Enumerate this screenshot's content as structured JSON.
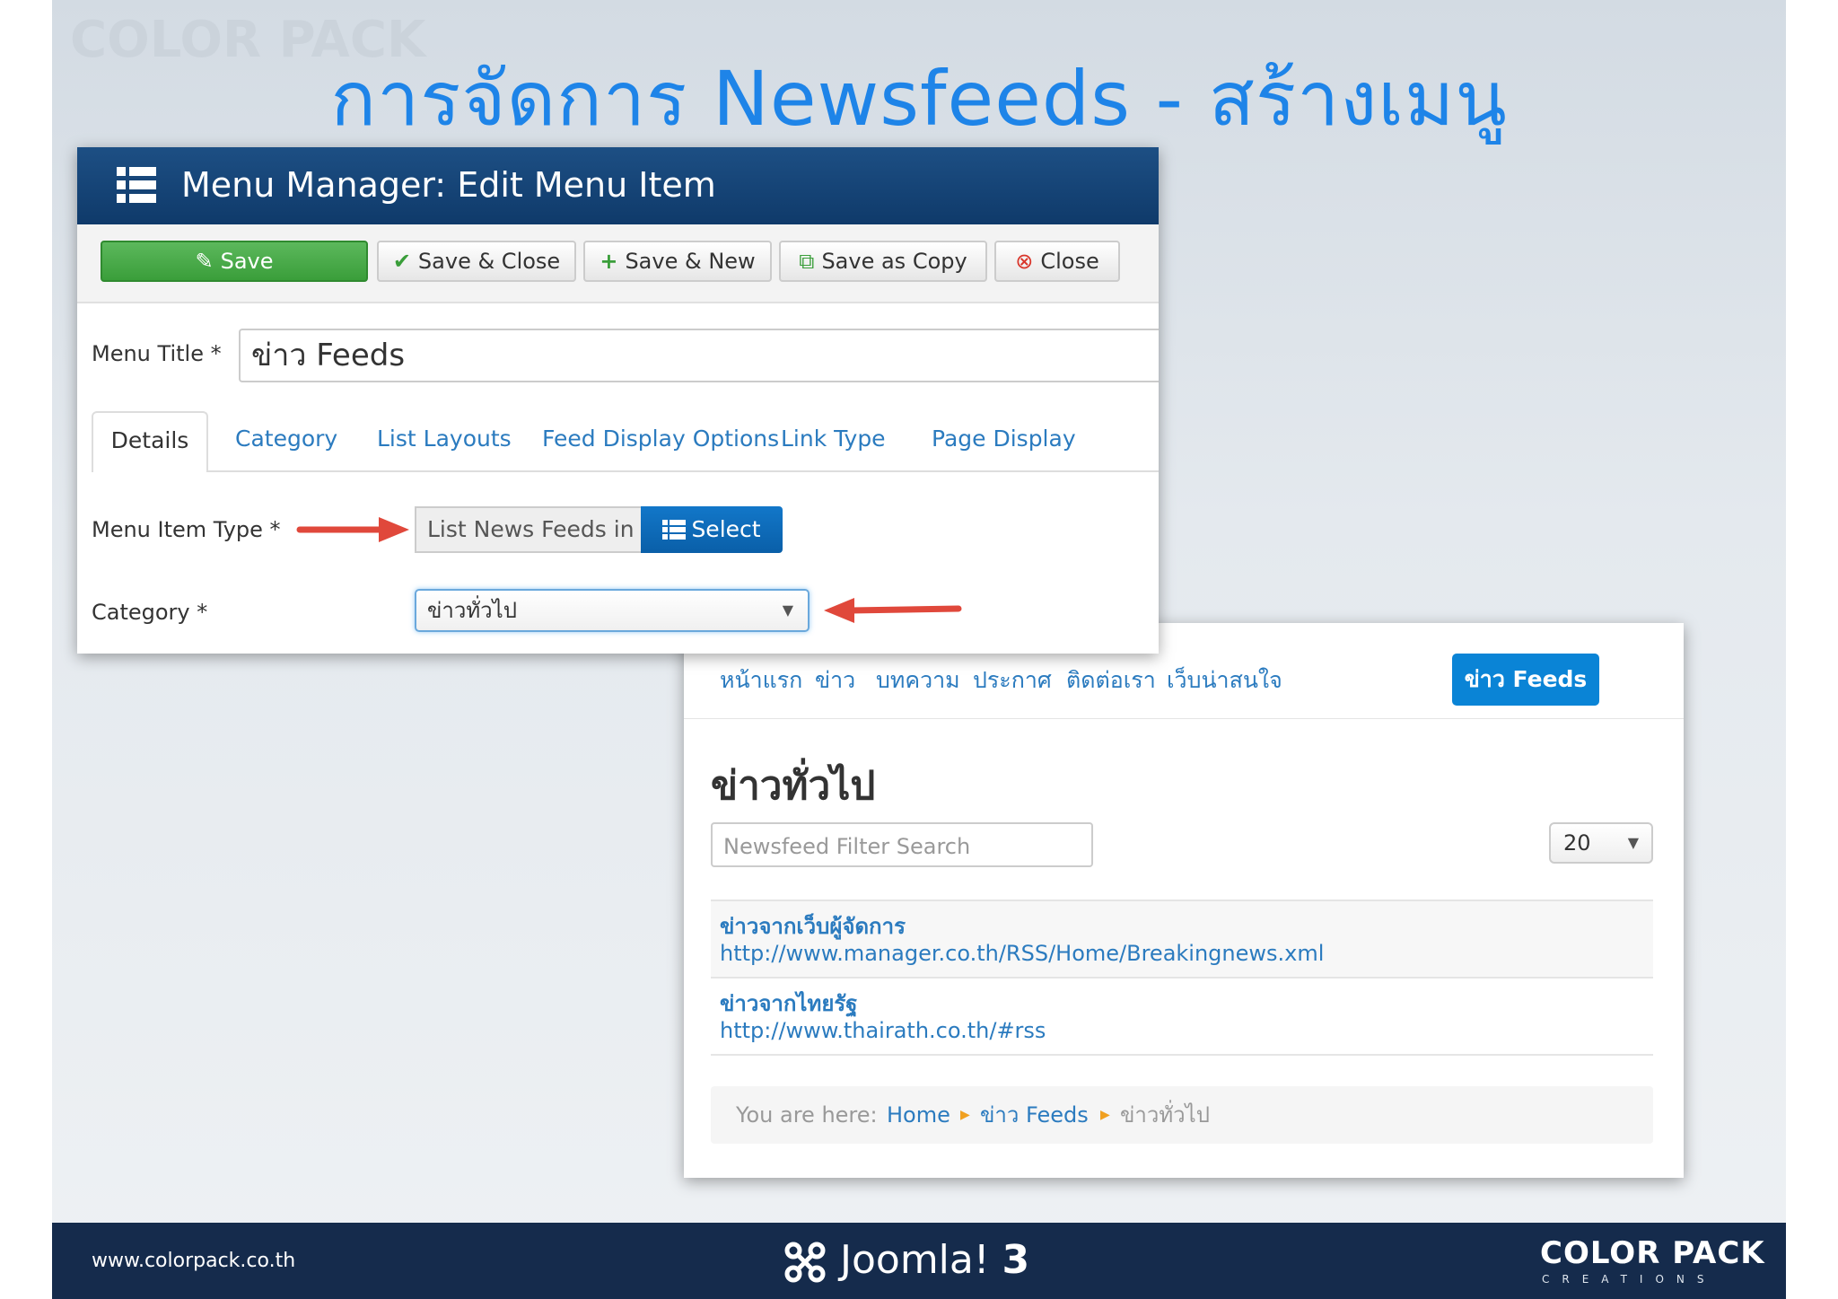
{
  "slide": {
    "title": "การจัดการ Newsfeeds - สร้างเมนู",
    "footer_url": "www.colorpack.co.th",
    "joomla_label": "Joomla!",
    "joomla_version": "3",
    "brand_name": "COLOR PACK",
    "brand_sub": "CREATIONS"
  },
  "editor": {
    "header_title": "Menu Manager: Edit Menu Item",
    "toolbar": {
      "save": "Save",
      "save_close": "Save & Close",
      "save_new": "Save & New",
      "save_copy": "Save as Copy",
      "close": "Close"
    },
    "menu_title_label": "Menu Title *",
    "menu_title_value": "ข่าว  Feeds",
    "tabs": {
      "details": "Details",
      "category": "Category",
      "list_layouts": "List Layouts",
      "feed_display": "Feed Display Options",
      "link_type": "Link Type",
      "page_display": "Page Display"
    },
    "menu_item_type_label": "Menu Item Type *",
    "menu_item_type_value": "List News Feeds in a Cate",
    "select_button": "Select",
    "category_label": "Category *",
    "category_value": "ข่าวทั่วไป"
  },
  "site": {
    "nav": {
      "home": "หน้าแรก",
      "news": "ข่าว",
      "articles": "บทความ",
      "announcements": "ประกาศ",
      "contact": "ติดต่อเรา",
      "links": "เว็บน่าสนใจ",
      "active": "ข่าว Feeds"
    },
    "category_heading": "ข่าวทั่วไป",
    "filter_placeholder": "Newsfeed Filter Search",
    "limit": "20",
    "feeds": {
      "f1_name": "ข่าวจากเว็บผู้จัดการ",
      "f1_url": "http://www.manager.co.th/RSS/Home/Breakingnews.xml",
      "f2_name": "ข่าวจากไทยรัฐ",
      "f2_url": "http://www.thairath.co.th/#rss"
    },
    "breadcrumb": {
      "prefix": "You are here:",
      "home": "Home",
      "feeds": "ข่าว Feeds",
      "current": "ข่าวทั่วไป"
    }
  },
  "colors": {
    "title_blue": "#1e84e8",
    "header_navy": "#15477a",
    "save_green": "#4cae4c",
    "select_blue": "#0a6cc0",
    "link_blue": "#2b7bbf",
    "arrow_red": "#e0483b",
    "footer_navy": "#152b4c"
  }
}
